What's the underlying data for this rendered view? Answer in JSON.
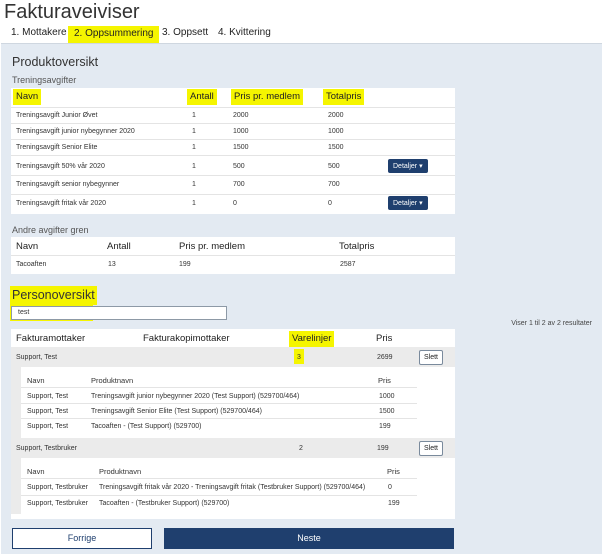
{
  "title": "Fakturaveiviser",
  "steps": [
    "1. Mottakere",
    "2. Oppsummering",
    "3. Oppsett",
    "4. Kvittering"
  ],
  "produktoversikt": {
    "heading": "Produktoversikt",
    "subheading": "Treningsavgifter",
    "columns": [
      "Navn",
      "Antall",
      "Pris pr. medlem",
      "Totalpris"
    ],
    "rows": [
      {
        "navn": "Treningsavgift Junior Øvet",
        "antall": "1",
        "pris": "2000",
        "total": "2000"
      },
      {
        "navn": "Treningsavgift junior nybegynner 2020",
        "antall": "1",
        "pris": "1000",
        "total": "1000"
      },
      {
        "navn": "Treningsavgift Senior Elite",
        "antall": "1",
        "pris": "1500",
        "total": "1500"
      },
      {
        "navn": "Treningsavgift 50% vår 2020",
        "antall": "1",
        "pris": "500",
        "total": "500"
      },
      {
        "navn": "Treningsavgift senior nybegynner",
        "antall": "1",
        "pris": "700",
        "total": "700"
      },
      {
        "navn": "Treningsavgift fritak vår 2020",
        "antall": "1",
        "pris": "0",
        "total": "0"
      }
    ],
    "details_label": "Detaljer ▾"
  },
  "andre": {
    "subheading": "Andre avgifter gren",
    "columns": [
      "Navn",
      "Antall",
      "Pris pr. medlem",
      "Totalpris"
    ],
    "rows": [
      {
        "navn": "Tacoaften",
        "antall": "13",
        "pris": "199",
        "total": "2587"
      }
    ]
  },
  "personoversikt": {
    "heading": "Personoversikt",
    "search_value": "test",
    "count_text": "Viser 1 til 2 av 2 resultater",
    "columns": [
      "Fakturamottaker",
      "Fakturakopimottaker",
      "Varelinjer",
      "Pris"
    ],
    "slett_label": "Slett",
    "groups": [
      {
        "mottaker": "Support, Test",
        "varelinjer": "3",
        "pris": "2699",
        "sub_columns": [
          "Navn",
          "Produktnavn",
          "Pris"
        ],
        "lines": [
          {
            "navn": "Support, Test",
            "produkt": "Treningsavgift junior nybegynner 2020 (Test Support) (529700/464)",
            "pris": "1000"
          },
          {
            "navn": "Support, Test",
            "produkt": "Treningsavgift Senior Elite (Test Support) (529700/464)",
            "pris": "1500"
          },
          {
            "navn": "Support, Test",
            "produkt": "Tacoaften - (Test Support) (529700)",
            "pris": "199"
          }
        ]
      },
      {
        "mottaker": "Support, Testbruker",
        "varelinjer": "2",
        "pris": "199",
        "sub_columns": [
          "Navn",
          "Produktnavn",
          "Pris"
        ],
        "lines": [
          {
            "navn": "Support, Testbruker",
            "produkt": "Treningsavgift fritak vår 2020 - Treningsavgift fritak (Testbruker Support) (529700/464)",
            "pris": "0"
          },
          {
            "navn": "Support, Testbruker",
            "produkt": "Tacoaften - (Testbruker Support) (529700)",
            "pris": "199"
          }
        ]
      }
    ]
  },
  "buttons": {
    "forrige": "Forrige",
    "neste": "Neste"
  },
  "colors": {
    "highlight": "#f5f500",
    "primary": "#1f3f6e",
    "panel": "#e3eaf2"
  }
}
